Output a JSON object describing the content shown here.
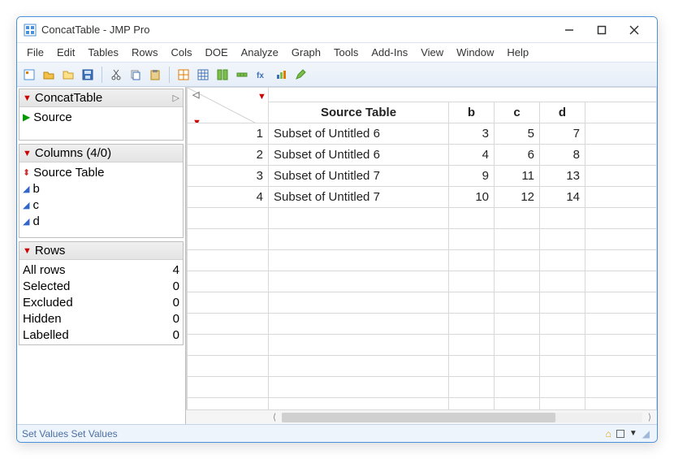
{
  "window": {
    "title": "ConcatTable - JMP Pro"
  },
  "menus": [
    "File",
    "Edit",
    "Tables",
    "Rows",
    "Cols",
    "DOE",
    "Analyze",
    "Graph",
    "Tools",
    "Add-Ins",
    "View",
    "Window",
    "Help"
  ],
  "left": {
    "table_panel": {
      "name": "ConcatTable",
      "items": [
        "Source"
      ]
    },
    "columns_panel": {
      "title": "Columns (4/0)",
      "columns": [
        {
          "name": "Source Table",
          "type": "char"
        },
        {
          "name": "b",
          "type": "num"
        },
        {
          "name": "c",
          "type": "num"
        },
        {
          "name": "d",
          "type": "num"
        }
      ]
    },
    "rows_panel": {
      "title": "Rows",
      "items": [
        {
          "label": "All rows",
          "value": 4
        },
        {
          "label": "Selected",
          "value": 0
        },
        {
          "label": "Excluded",
          "value": 0
        },
        {
          "label": "Hidden",
          "value": 0
        },
        {
          "label": "Labelled",
          "value": 0
        }
      ]
    }
  },
  "grid": {
    "headers": [
      "Source Table",
      "b",
      "c",
      "d"
    ],
    "rows": [
      {
        "n": 1,
        "src": "Subset of Untitled 6",
        "b": 3,
        "c": 5,
        "d": 7
      },
      {
        "n": 2,
        "src": "Subset of Untitled 6",
        "b": 4,
        "c": 6,
        "d": 8
      },
      {
        "n": 3,
        "src": "Subset of Untitled 7",
        "b": 9,
        "c": 11,
        "d": 13
      },
      {
        "n": 4,
        "src": "Subset of Untitled 7",
        "b": 10,
        "c": 12,
        "d": 14
      }
    ]
  },
  "status": {
    "left": "Set Values  Set Values"
  }
}
